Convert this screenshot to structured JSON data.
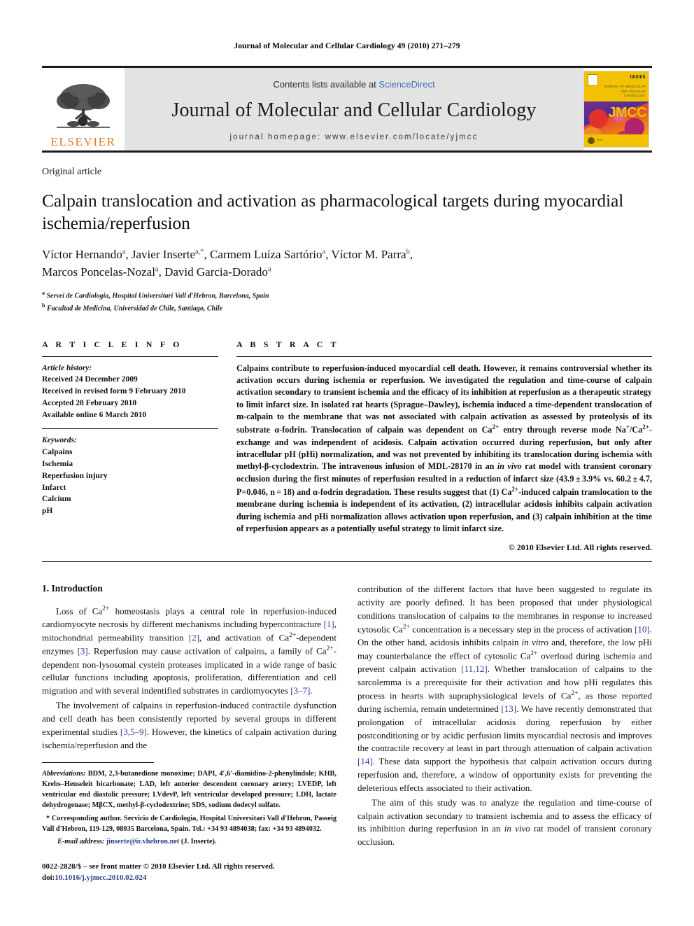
{
  "running_head": "Journal of Molecular and Cellular Cardiology 49 (2010) 271–279",
  "masthead": {
    "contents_prefix": "Contents lists available at ",
    "sciencedirect": "ScienceDirect",
    "journal_title": "Journal of Molecular and Cellular Cardiology",
    "homepage": "journal homepage: www.elsevier.com/locate/yjmcc",
    "publisher_wordmark": "ELSEVIER",
    "cover": {
      "title_lines": "JOURNAL OF MOLECULAR AND CELLULAR CARDIOLOGY",
      "acronym": "JMCC",
      "society_text": "ISHR"
    }
  },
  "article": {
    "type": "Original article",
    "title": "Calpain translocation and activation as pharmacological targets during myocardial ischemia/reperfusion",
    "authors_line1_parts": [
      {
        "name": "Víctor Hernando",
        "marker": "a"
      },
      {
        "name": "Javier Inserte",
        "marker": "a,*"
      },
      {
        "name": "Carmem Luíza Sartório",
        "marker": "a"
      },
      {
        "name": "Víctor M. Parra",
        "marker": "b"
      }
    ],
    "authors_line2_parts": [
      {
        "name": "Marcos Poncelas-Nozal",
        "marker": "a"
      },
      {
        "name": "David Garcia-Dorado",
        "marker": "a"
      }
    ],
    "affiliations": [
      {
        "marker": "a",
        "text": "Servei de Cardiologia, Hospital Universitari Vall d'Hebron, Barcelona, Spain"
      },
      {
        "marker": "b",
        "text": "Facultad de Medicina, Universidad de Chile, Santiago, Chile"
      }
    ]
  },
  "info": {
    "label": "A R T I C L E    I N F O",
    "history_label": "Article history:",
    "history": [
      "Received 24 December 2009",
      "Received in revised form 9 February 2010",
      "Accepted 28 February 2010",
      "Available online 6 March 2010"
    ],
    "keywords_label": "Keywords:",
    "keywords": [
      "Calpains",
      "Ischemia",
      "Reperfusion injury",
      "Infarct",
      "Calcium",
      "pH"
    ]
  },
  "abstract": {
    "label": "A B S T R A C T",
    "copyright": "© 2010 Elsevier Ltd. All rights reserved."
  },
  "intro": {
    "heading": "1. Introduction"
  },
  "footnotes": {
    "abbreviations_label": "Abbreviations:",
    "corresponding_marker": "*",
    "corresponding_label": "Corresponding author.",
    "email_label": "E-mail address:",
    "email": "jinserte@ir.vhebron.net",
    "email_suffix": "(J. Inserte).",
    "issn_line": "0022-2828/$ – see front matter © 2010 Elsevier Ltd. All rights reserved.",
    "doi_label": "doi:",
    "doi": "10.1016/j.yjmcc.2010.02.024"
  },
  "colors": {
    "link": "#2c3d8f",
    "sciencedirect": "#3f6fb5",
    "elsevier_orange": "#E87722",
    "band": "#e3e3e3",
    "cover_yellow": "#f2c200"
  }
}
